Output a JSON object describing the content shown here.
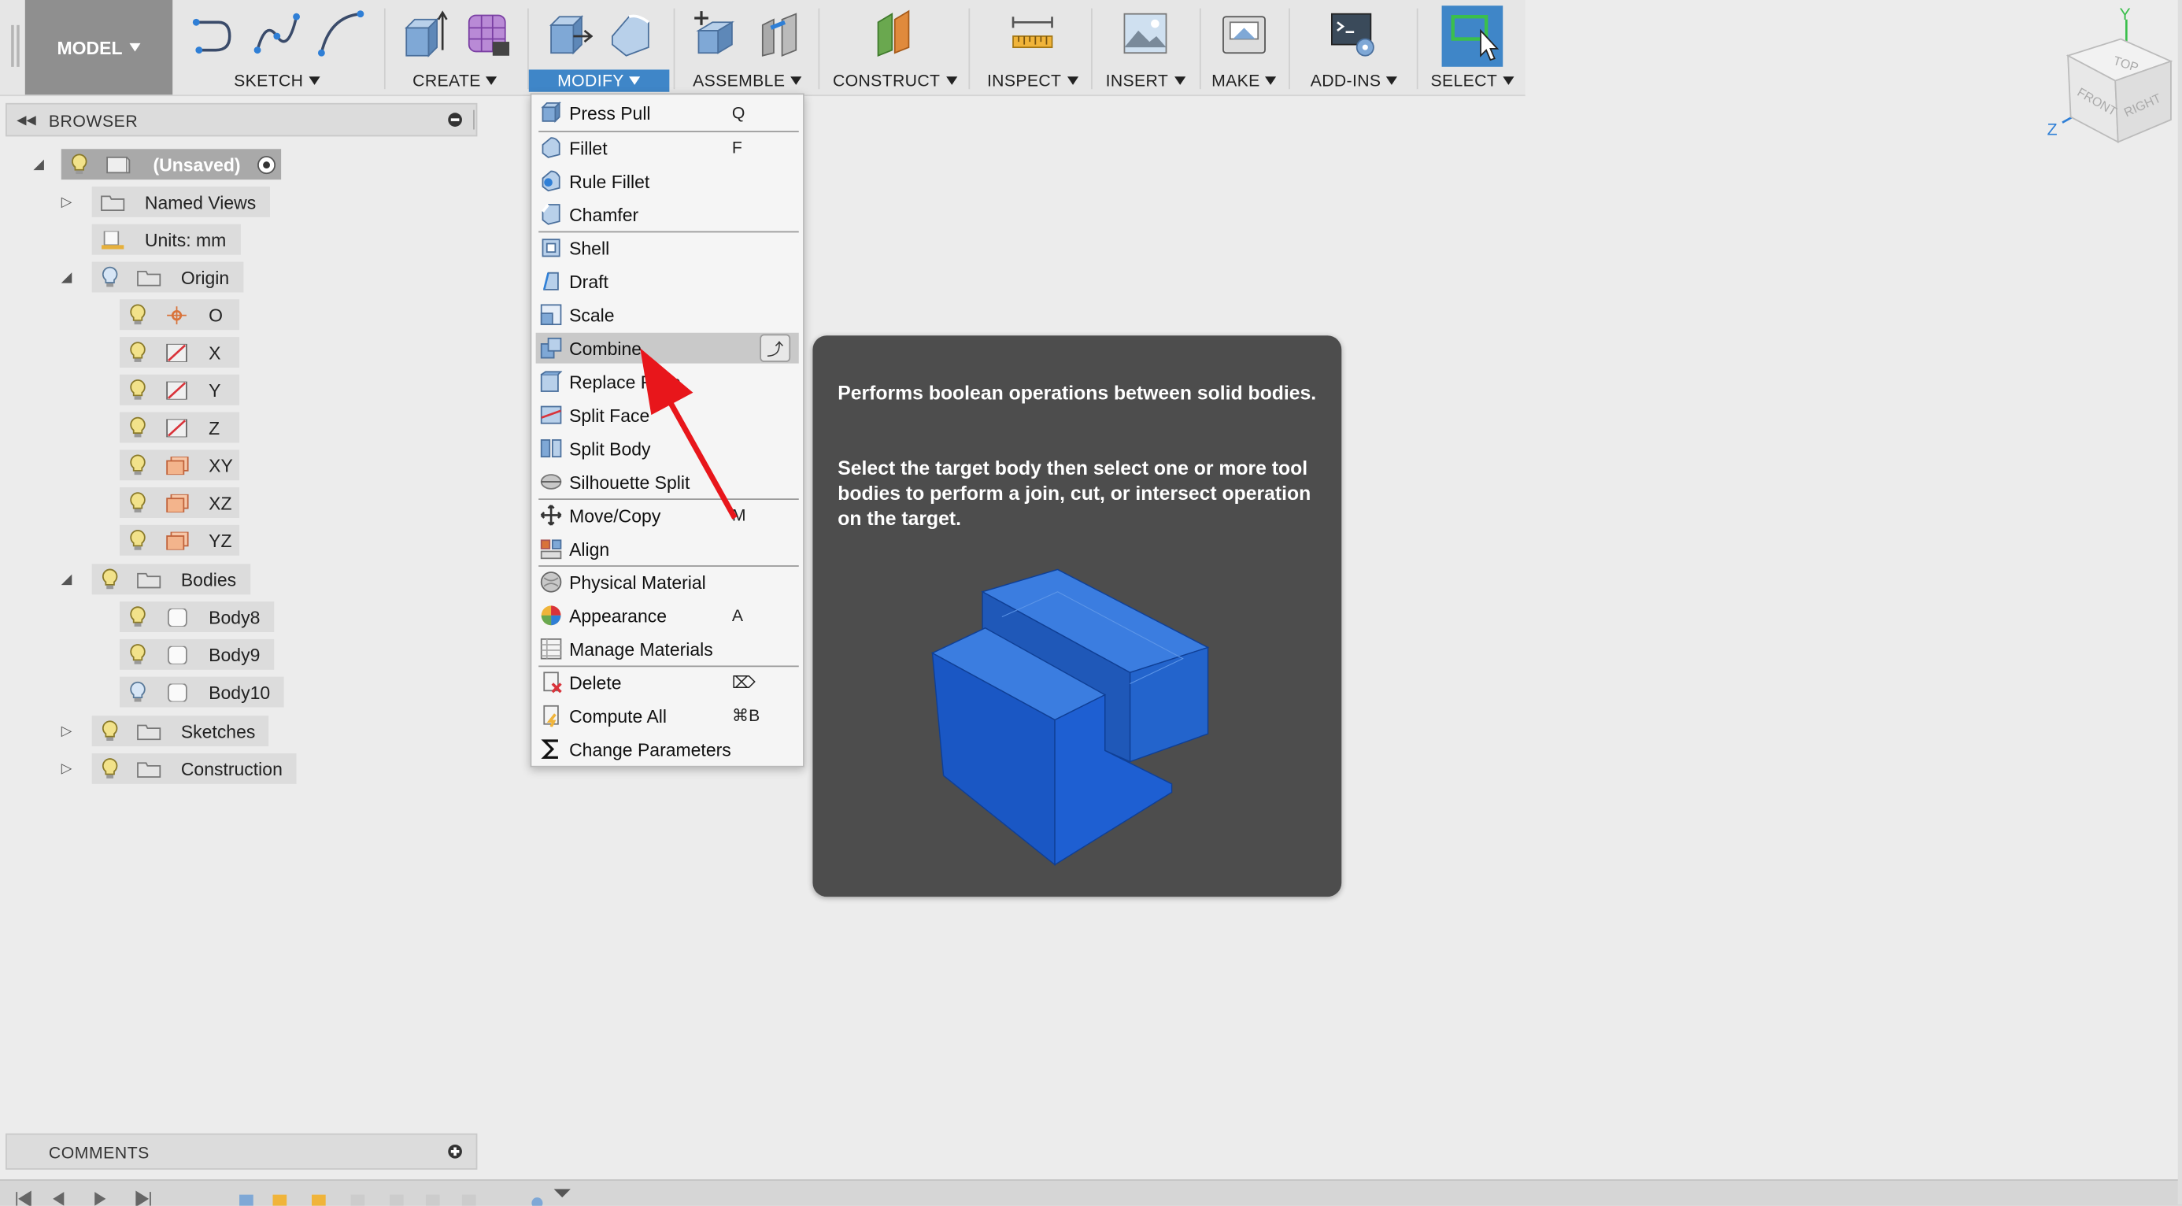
{
  "toolbar": {
    "model_label": "MODEL",
    "groups": [
      {
        "label": "SKETCH"
      },
      {
        "label": "CREATE"
      },
      {
        "label": "MODIFY"
      },
      {
        "label": "ASSEMBLE"
      },
      {
        "label": "CONSTRUCT"
      },
      {
        "label": "INSPECT"
      },
      {
        "label": "INSERT"
      },
      {
        "label": "MAKE"
      },
      {
        "label": "ADD-INS"
      },
      {
        "label": "SELECT"
      }
    ]
  },
  "browser": {
    "title": "BROWSER",
    "root": "(Unsaved)",
    "items": [
      {
        "label": "Named Views"
      },
      {
        "label": "Units: mm"
      },
      {
        "label": "Origin"
      },
      {
        "label": "O"
      },
      {
        "label": "X"
      },
      {
        "label": "Y"
      },
      {
        "label": "Z"
      },
      {
        "label": "XY"
      },
      {
        "label": "XZ"
      },
      {
        "label": "YZ"
      },
      {
        "label": "Bodies"
      },
      {
        "label": "Body8"
      },
      {
        "label": "Body9"
      },
      {
        "label": "Body10"
      },
      {
        "label": "Sketches"
      },
      {
        "label": "Construction"
      }
    ]
  },
  "menu": {
    "items": [
      {
        "label": "Press Pull",
        "shortcut": "Q"
      },
      {
        "label": "Fillet",
        "shortcut": "F"
      },
      {
        "label": "Rule Fillet",
        "shortcut": ""
      },
      {
        "label": "Chamfer",
        "shortcut": ""
      },
      {
        "label": "Shell",
        "shortcut": ""
      },
      {
        "label": "Draft",
        "shortcut": ""
      },
      {
        "label": "Scale",
        "shortcut": ""
      },
      {
        "label": "Combine",
        "shortcut": ""
      },
      {
        "label": "Replace Face",
        "shortcut": ""
      },
      {
        "label": "Split Face",
        "shortcut": ""
      },
      {
        "label": "Split Body",
        "shortcut": ""
      },
      {
        "label": "Silhouette Split",
        "shortcut": ""
      },
      {
        "label": "Move/Copy",
        "shortcut": "M"
      },
      {
        "label": "Align",
        "shortcut": ""
      },
      {
        "label": "Physical Material",
        "shortcut": ""
      },
      {
        "label": "Appearance",
        "shortcut": "A"
      },
      {
        "label": "Manage Materials",
        "shortcut": ""
      },
      {
        "label": "Delete",
        "shortcut": "⌦"
      },
      {
        "label": "Compute All",
        "shortcut": "⌘B"
      },
      {
        "label": "Change Parameters",
        "shortcut": ""
      }
    ]
  },
  "tooltip": {
    "line1": "Performs boolean operations between solid bodies.",
    "line2": "Select the target body then select one or more tool bodies to perform a join, cut, or intersect operation on the target."
  },
  "comments": {
    "title": "COMMENTS"
  },
  "viewcube": {
    "top": "TOP",
    "front": "FRONT",
    "right": "RIGHT",
    "axis_y": "Y",
    "axis_z": "Z"
  },
  "colors": {
    "accent": "#3f86c8",
    "body_blue": "#1f63d0",
    "arrow": "#e8161b"
  }
}
